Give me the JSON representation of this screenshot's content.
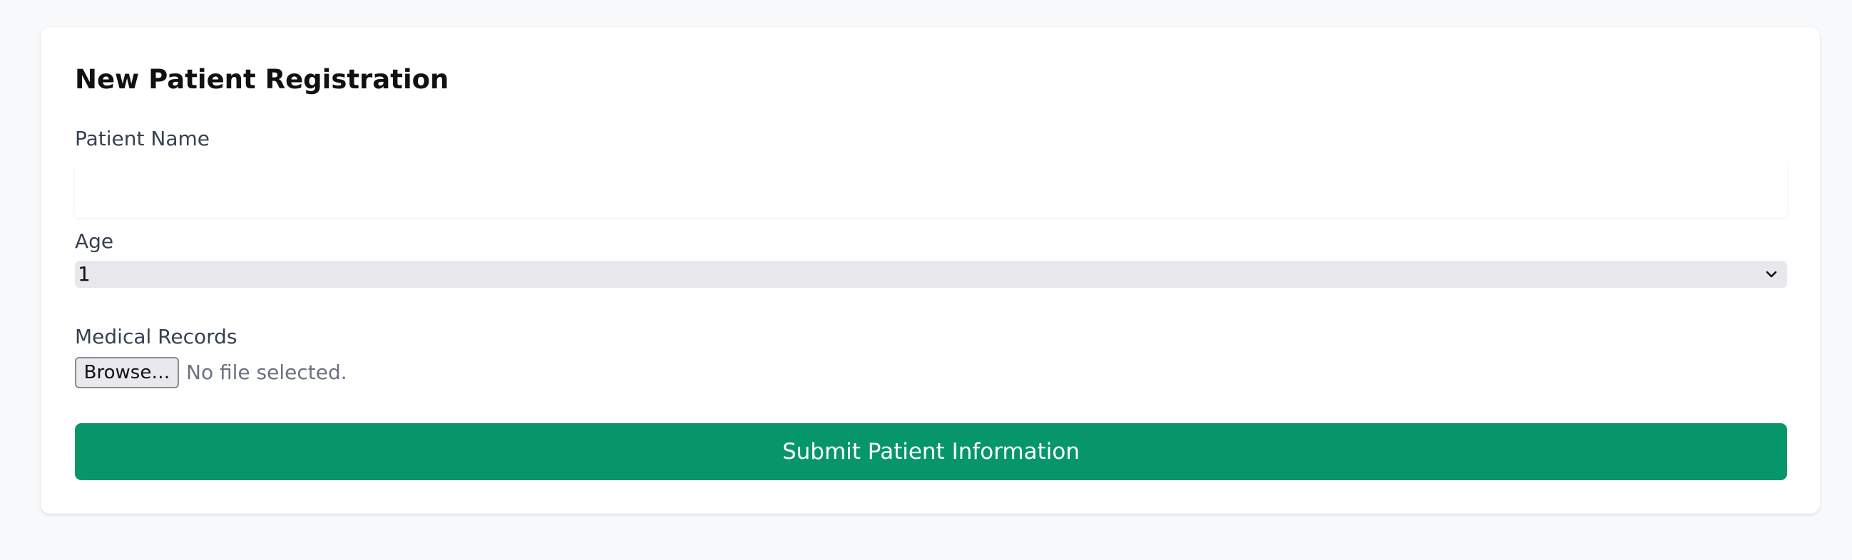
{
  "form": {
    "title": "New Patient Registration",
    "patient_name": {
      "label": "Patient Name",
      "value": "",
      "placeholder": ""
    },
    "age": {
      "label": "Age",
      "selected_value": "1"
    },
    "medical_records": {
      "label": "Medical Records",
      "browse_label": "Browse…",
      "file_status": "No file selected."
    },
    "submit_label": "Submit Patient Information"
  },
  "icons": {
    "select_arrow": "chevron-down-icon"
  },
  "colors": {
    "page_background": "#f8f9fb",
    "card_background": "#ffffff",
    "submit_button": "#07966a",
    "select_background": "#e8e8ec"
  }
}
